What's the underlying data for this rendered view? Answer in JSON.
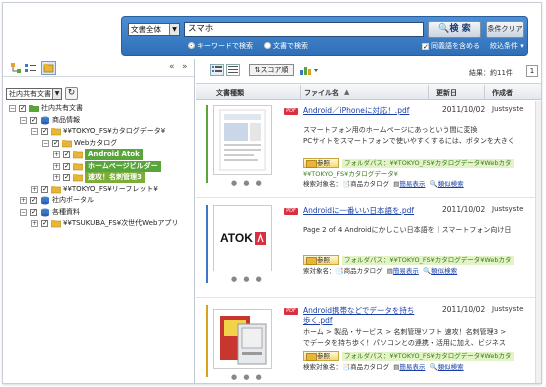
{
  "search": {
    "scope": "文書全体",
    "query": "スマホ",
    "search_label": "検 索",
    "clear_label": "条件クリア",
    "mode_keyword": "キーワードで検索",
    "mode_document": "文書で検索",
    "synonyms_label": "同義語を含める",
    "narrow_label": "絞込条件 ▾"
  },
  "sidebar": {
    "scope_select": "社内共有文書",
    "collapse": "«",
    "expand": "»",
    "tree": [
      {
        "label": "社内共有文書",
        "level": 0,
        "expand": "−"
      },
      {
        "label": "商品情報",
        "level": 1,
        "expand": "−"
      },
      {
        "label": "¥¥TOKYO_FS¥カタログデータ¥",
        "level": 2,
        "expand": "−"
      },
      {
        "label": "Webカタログ",
        "level": 3,
        "expand": "−"
      },
      {
        "label": "Android Atok",
        "level": 4,
        "expand": "+",
        "highlight": "hl"
      },
      {
        "label": "ホームページビルダー",
        "level": 4,
        "expand": "+",
        "highlight": "hl"
      },
      {
        "label": "速攻！名刺管理3",
        "level": 4,
        "expand": "+",
        "highlight": "hl2"
      },
      {
        "label": "¥¥TOKYO_FS¥リーフレット¥",
        "level": 2,
        "expand": "+"
      },
      {
        "label": "社内ポータル",
        "level": 1,
        "expand": "+"
      },
      {
        "label": "各種資料",
        "level": 1,
        "expand": "−"
      },
      {
        "label": "¥¥TSUKUBA_FS¥次世代Webアプリ",
        "level": 2,
        "expand": "+"
      }
    ]
  },
  "results": {
    "score_button": "スコア順",
    "count": "結果：約11件",
    "page": "1",
    "columns": {
      "type": "文書種類",
      "file": "ファイル名",
      "updated": "更新日",
      "author": "作成者"
    },
    "items": [
      {
        "badge": "PDF",
        "file": "Android／iPhoneに対応！.pdf",
        "date": "2011/10/02",
        "author": "Justsyste",
        "snippet1": "スマートフォン用のホームページにあっという間に変換",
        "snippet2": "PCサイトをスマートフォンで使いやすくするには、ボタンを大きく",
        "ref_label": "参照",
        "path": "フォルダパス：¥¥TOKYO_FS¥カタログデータ¥Webカタ",
        "path2": "¥¥TOKYO_FS¥カタログデータ¥",
        "meta_target": "検索対象名：",
        "meta_catalog": "商品カタログ",
        "meta_simple": "簡易表示",
        "meta_similar": "類似検索",
        "accent": "#5aa53b"
      },
      {
        "badge": "PDF",
        "file": "Androidに一番いい日本語を.pdf",
        "date": "2011/10/02",
        "author": "Justsyste",
        "snippet1": "Page 2 of 4 Androidにかしこい日本語を｜スマートフォン向け日",
        "snippet2": "",
        "ref_label": "参照",
        "path": "フォルダパス：¥¥TOKYO_FS¥カタログデータ¥Webカタ",
        "path2": "",
        "meta_target": "索対象名：",
        "meta_catalog": "商品カタログ",
        "meta_simple": "簡易表示",
        "meta_similar": "類似検索",
        "accent": "#3b76c7",
        "thumb_logo": "ATOK"
      },
      {
        "badge": "PDF",
        "file": "Android携帯などでデータを持ち",
        "file2": "歩く.pdf",
        "date": "2011/10/02",
        "author": "Justsyste",
        "snippet1": "ホーム > 製品・サービス > 名刺管理ソフト 速攻！名刺管理3 >",
        "snippet2": "でデータを持ち歩く！パソコンとの連携・活用に加え、ビジネス",
        "ref_label": "参照",
        "path": "フォルダパス：¥¥TOKYO_FS¥カタログデータ¥Webカタ",
        "path2": "",
        "meta_target": "検索対象名：",
        "meta_catalog": "商品カタログ",
        "meta_simple": "簡易表示",
        "meta_similar": "類似検索",
        "accent": "#d9a21d"
      }
    ]
  }
}
